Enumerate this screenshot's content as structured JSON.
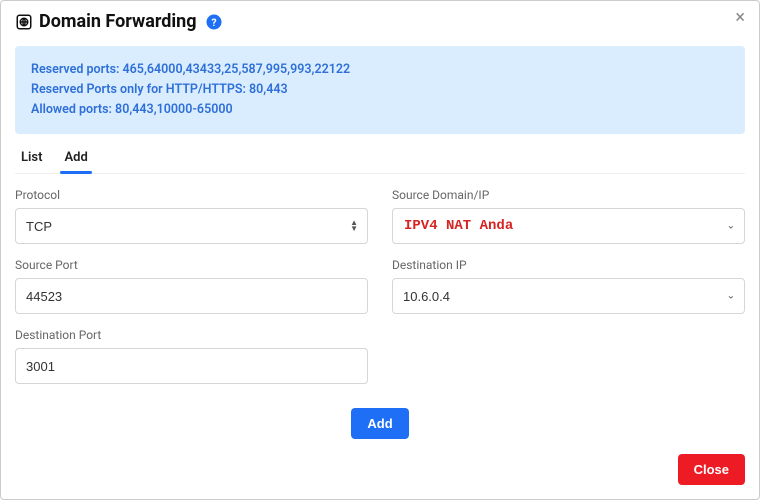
{
  "header": {
    "title": "Domain Forwarding",
    "close_label": "×"
  },
  "info": {
    "line1": "Reserved ports: 465,64000,43433,25,587,995,993,22122",
    "line2": "Reserved Ports only for HTTP/HTTPS: 80,443",
    "line3": "Allowed ports: 80,443,10000-65000"
  },
  "tabs": {
    "list": "List",
    "add": "Add"
  },
  "form": {
    "protocol_label": "Protocol",
    "protocol_value": "TCP",
    "source_domain_label": "Source Domain/IP",
    "source_domain_value": "",
    "source_domain_overlay": "IPV4 NAT Anda",
    "source_port_label": "Source Port",
    "source_port_value": "44523",
    "dest_ip_label": "Destination IP",
    "dest_ip_value": "10.6.0.4",
    "dest_port_label": "Destination Port",
    "dest_port_value": "3001",
    "add_button": "Add"
  },
  "footer": {
    "close_button": "Close"
  }
}
